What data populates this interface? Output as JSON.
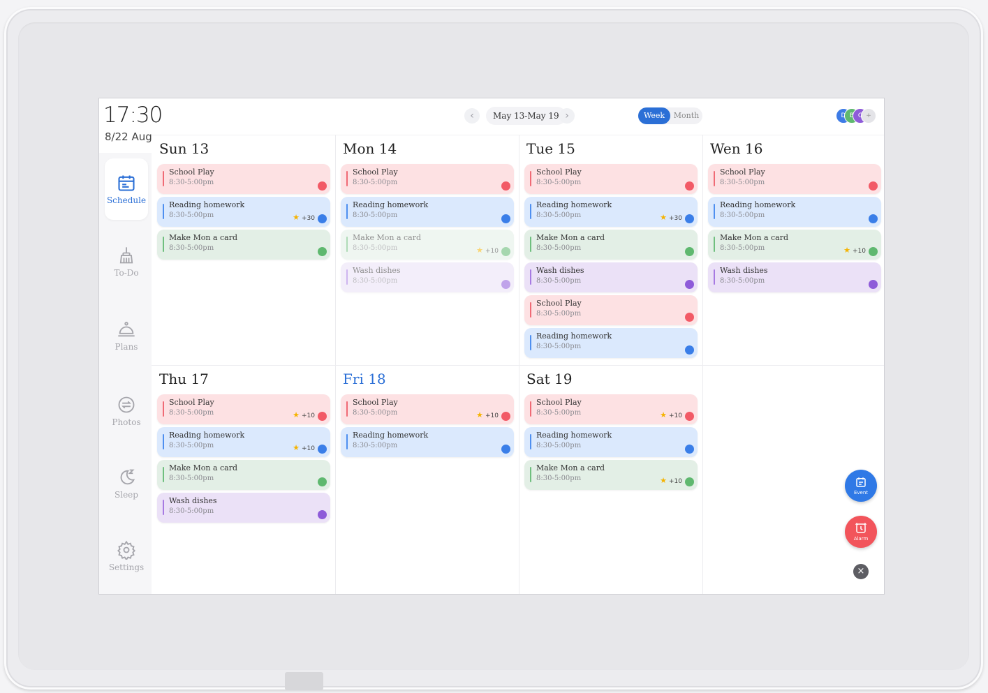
{
  "clock": {
    "time": "17:30",
    "date": "8/22 Aug"
  },
  "sidebar": {
    "items": [
      {
        "label": "Schedule",
        "icon": "calendar-icon",
        "active": true
      },
      {
        "label": "To-Do",
        "icon": "broom-icon"
      },
      {
        "label": "Plans",
        "icon": "cloche-icon"
      },
      {
        "label": "Photos",
        "icon": "photos-icon"
      },
      {
        "label": "Sleep",
        "icon": "moon-icon"
      },
      {
        "label": "Settings",
        "icon": "gear-icon"
      }
    ]
  },
  "topbar": {
    "prev": "‹",
    "range": "May 13-May 19",
    "next": "›",
    "view_week": "Week",
    "view_month": "Month",
    "avatars": [
      "D",
      "B",
      "C",
      "+"
    ]
  },
  "colors": {
    "accent": "#2b6fd6",
    "red": "#f25a66",
    "blue": "#3a7ee8",
    "green": "#5fb86f",
    "purple": "#8e5bd9"
  },
  "days": [
    {
      "title": "Sun 13",
      "events": [
        {
          "title": "School Play",
          "time": "8:30-5:00pm",
          "color": "red"
        },
        {
          "title": "Reading homework",
          "time": "8:30-5:00pm",
          "color": "blue",
          "points": "+30"
        },
        {
          "title": "Make Mon a card",
          "time": "8:30-5:00pm",
          "color": "green"
        }
      ]
    },
    {
      "title": "Mon 14",
      "events": [
        {
          "title": "School Play",
          "time": "8:30-5:00pm",
          "color": "red"
        },
        {
          "title": "Reading homework",
          "time": "8:30-5:00pm",
          "color": "blue"
        },
        {
          "title": "Make Mon a card",
          "time": "8:30-5:00pm",
          "color": "green",
          "points": "+10",
          "faded": true
        },
        {
          "title": "Wash dishes",
          "time": "8:30-5:00pm",
          "color": "purple",
          "faded": true
        }
      ]
    },
    {
      "title": "Tue 15",
      "events": [
        {
          "title": "School Play",
          "time": "8:30-5:00pm",
          "color": "red"
        },
        {
          "title": "Reading homework",
          "time": "8:30-5:00pm",
          "color": "blue",
          "points": "+30"
        },
        {
          "title": "Make Mon a card",
          "time": "8:30-5:00pm",
          "color": "green"
        },
        {
          "title": "Wash dishes",
          "time": "8:30-5:00pm",
          "color": "purple"
        },
        {
          "title": "School Play",
          "time": "8:30-5:00pm",
          "color": "red"
        },
        {
          "title": "Reading homework",
          "time": "8:30-5:00pm",
          "color": "blue"
        }
      ]
    },
    {
      "title": "Wen 16",
      "events": [
        {
          "title": "School Play",
          "time": "8:30-5:00pm",
          "color": "red"
        },
        {
          "title": "Reading homework",
          "time": "8:30-5:00pm",
          "color": "blue"
        },
        {
          "title": "Make Mon a card",
          "time": "8:30-5:00pm",
          "color": "green",
          "points": "+10"
        },
        {
          "title": "Wash dishes",
          "time": "8:30-5:00pm",
          "color": "purple"
        }
      ]
    },
    {
      "title": "Thu 17",
      "events": [
        {
          "title": "School Play",
          "time": "8:30-5:00pm",
          "color": "red",
          "points": "+10"
        },
        {
          "title": "Reading homework",
          "time": "8:30-5:00pm",
          "color": "blue",
          "points": "+10"
        },
        {
          "title": "Make Mon a card",
          "time": "8:30-5:00pm",
          "color": "green"
        },
        {
          "title": "Wash dishes",
          "time": "8:30-5:00pm",
          "color": "purple"
        }
      ]
    },
    {
      "title": "Fri 18",
      "today": true,
      "events": [
        {
          "title": "School Play",
          "time": "8:30-5:00pm",
          "color": "red",
          "points": "+10"
        },
        {
          "title": "Reading homework",
          "time": "8:30-5:00pm",
          "color": "blue"
        }
      ]
    },
    {
      "title": "Sat 19",
      "events": [
        {
          "title": "School Play",
          "time": "8:30-5:00pm",
          "color": "red",
          "points": "+10"
        },
        {
          "title": "Reading homework",
          "time": "8:30-5:00pm",
          "color": "blue"
        },
        {
          "title": "Make Mon a card",
          "time": "8:30-5:00pm",
          "color": "green",
          "points": "+10"
        }
      ]
    }
  ],
  "fab": {
    "event_label": "Event",
    "alarm_label": "Alarm",
    "close": "×"
  }
}
